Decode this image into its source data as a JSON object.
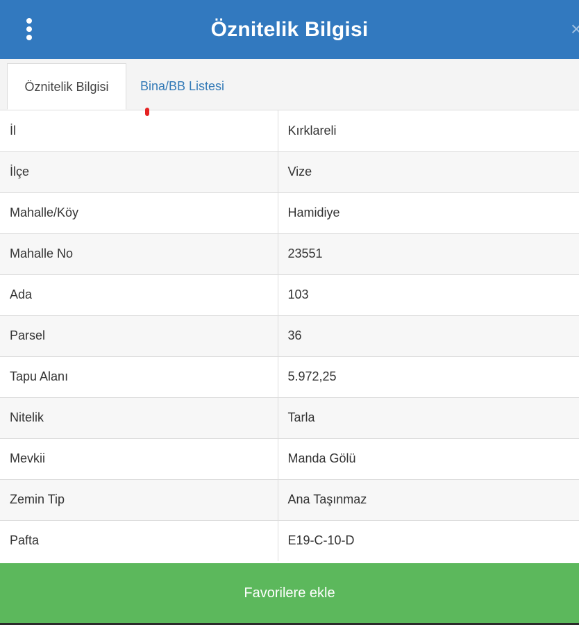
{
  "header": {
    "title": "Öznitelik Bilgisi",
    "close_glyph": "×",
    "menu_icon": "vertical-ellipsis-icon",
    "color": "#3279bf"
  },
  "tabs": [
    {
      "label": "Öznitelik Bilgisi",
      "active": true
    },
    {
      "label": "Bina/BB Listesi",
      "active": false
    }
  ],
  "attributes": [
    {
      "key": "İl",
      "value": "Kırklareli"
    },
    {
      "key": "İlçe",
      "value": "Vize"
    },
    {
      "key": "Mahalle/Köy",
      "value": "Hamidiye"
    },
    {
      "key": "Mahalle No",
      "value": "23551"
    },
    {
      "key": "Ada",
      "value": "103"
    },
    {
      "key": "Parsel",
      "value": "36"
    },
    {
      "key": "Tapu Alanı",
      "value": "5.972,25"
    },
    {
      "key": "Nitelik",
      "value": "Tarla"
    },
    {
      "key": "Mevkii",
      "value": "Manda Gölü"
    },
    {
      "key": "Zemin Tip",
      "value": "Ana Taşınmaz"
    },
    {
      "key": "Pafta",
      "value": "E19-C-10-D"
    }
  ],
  "footer": {
    "favorite_label": "Favorilere ekle",
    "color": "#5cb85c"
  }
}
